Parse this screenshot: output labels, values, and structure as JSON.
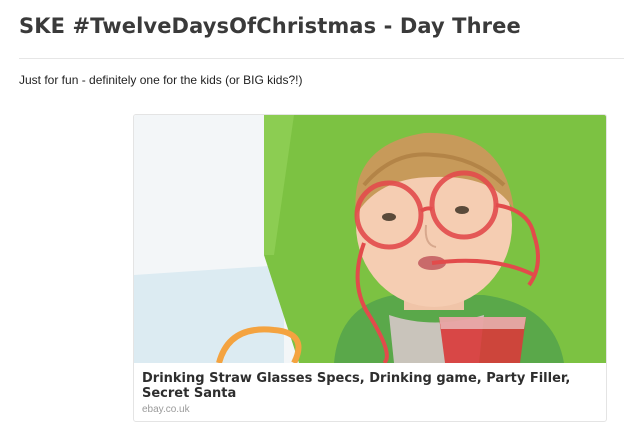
{
  "post": {
    "title": "SKE #TwelveDaysOfChristmas - Day Three",
    "body": "Just for fun - definitely one for the kids (or BIG kids?!)"
  },
  "link_card": {
    "title": "Drinking Straw Glasses Specs, Drinking game, Party Filler, Secret Santa",
    "source": "ebay.co.uk",
    "image_subject": "boy-wearing-straw-glasses"
  },
  "colors": {
    "title_text": "#3a3a3a",
    "background_green": "#7cc242",
    "straw_red": "#e24b4b",
    "straw_orange": "#f4a340"
  }
}
